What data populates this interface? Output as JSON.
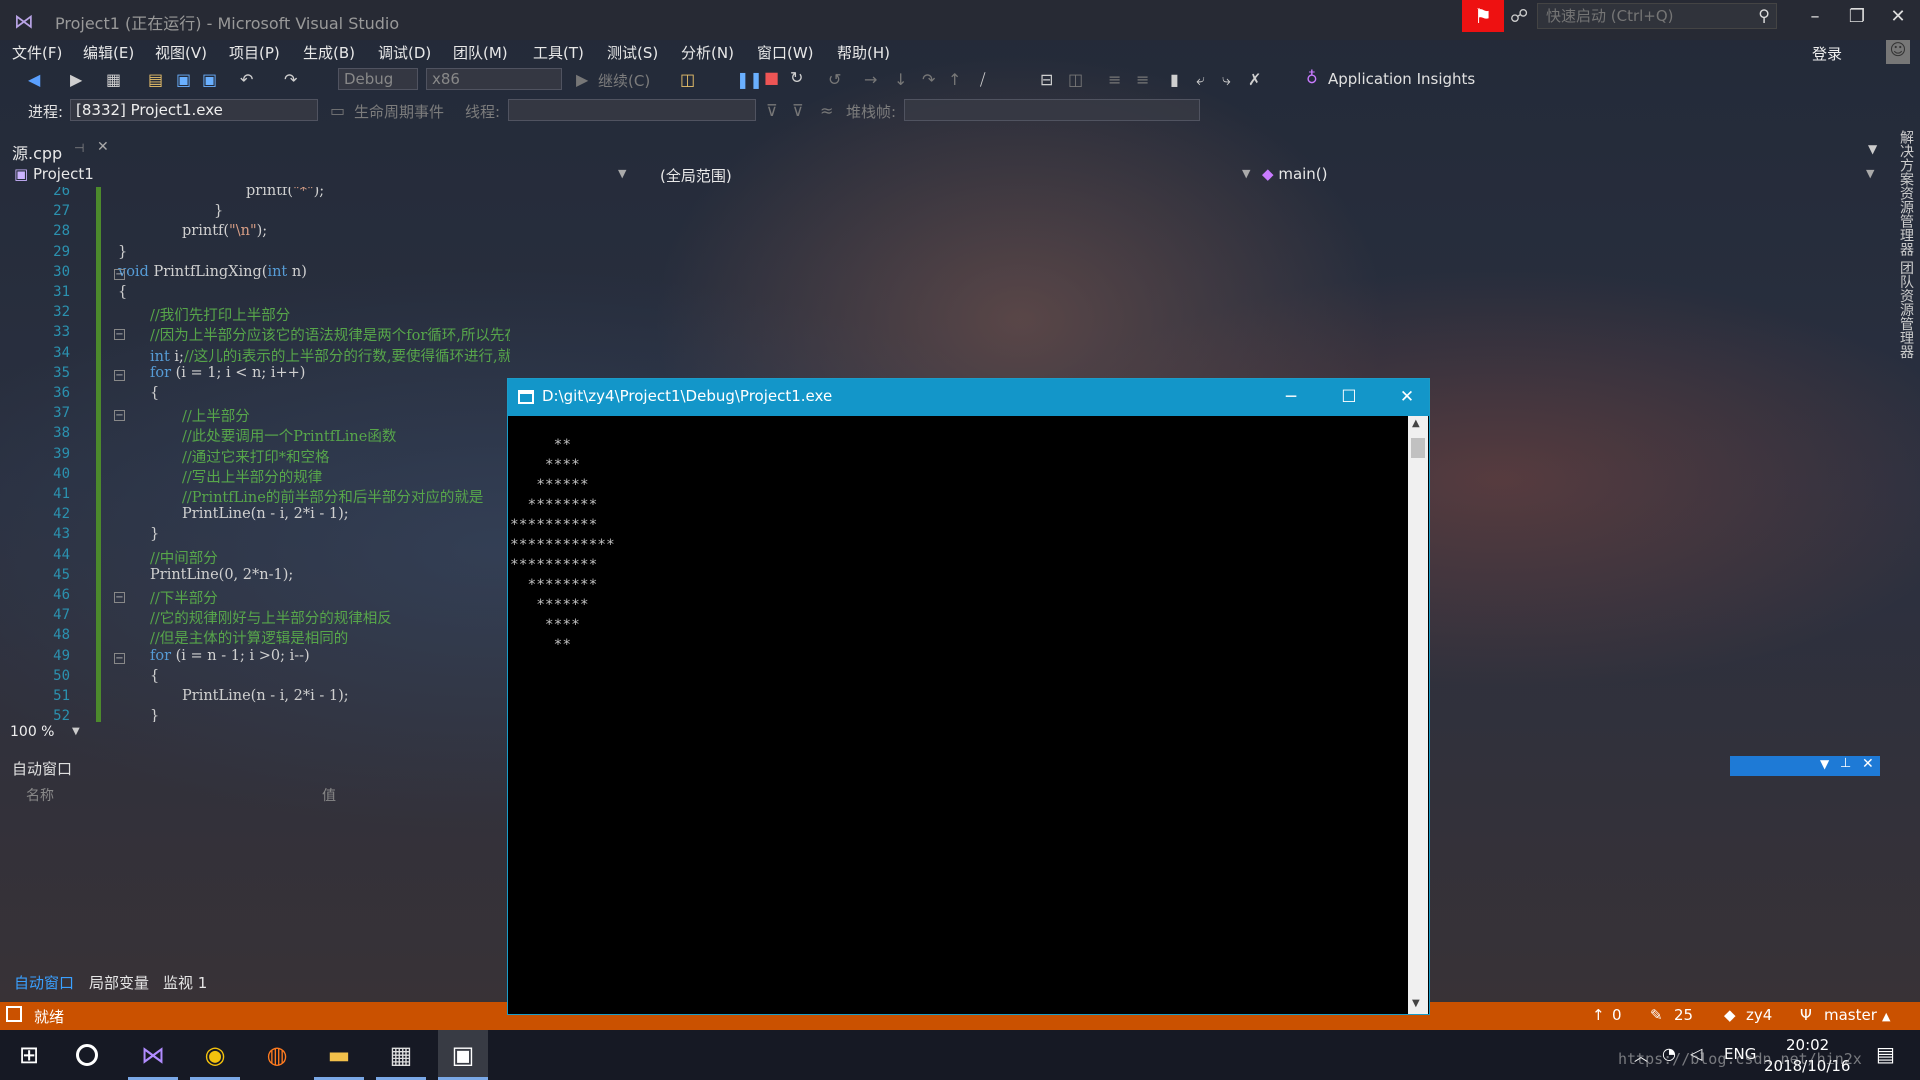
{
  "window": {
    "title": "Project1 (正在运行) - Microsoft Visual Studio",
    "quick_launch_placeholder": "快速启动 (Ctrl+Q)",
    "sign_in": "登录"
  },
  "menu": [
    "文件(F)",
    "编辑(E)",
    "视图(V)",
    "项目(P)",
    "生成(B)",
    "调试(D)",
    "团队(M)",
    "工具(T)",
    "测试(S)",
    "分析(N)",
    "窗口(W)",
    "帮助(H)"
  ],
  "toolbar": {
    "config": "Debug",
    "platform": "x86",
    "continue_label": "继续(C)",
    "app_insights": "Application Insights"
  },
  "debug_location": {
    "process_label": "进程:",
    "process_value": "[8332] Project1.exe",
    "lifecycle_label": "生命周期事件",
    "thread_label": "线程:",
    "stackframe_label": "堆栈帧:"
  },
  "doc_tab": {
    "label": "源.cpp"
  },
  "nav": {
    "project": "Project1",
    "scope": "(全局范围)",
    "member": "main()"
  },
  "editor": {
    "zoom": "100 %",
    "line_numbers": [
      "26",
      "27",
      "28",
      "29",
      "30",
      "31",
      "32",
      "33",
      "34",
      "35",
      "36",
      "37",
      "38",
      "39",
      "40",
      "41",
      "42",
      "43",
      "44",
      "45",
      "46",
      "47",
      "48",
      "49",
      "50",
      "51",
      "52"
    ],
    "lines": [
      "printf(\"*\");",
      "}",
      "printf(\"\\n\");",
      "}",
      "void PrintfLingXing(int n)",
      "{",
      "//我们先打印上半部分",
      "//因为上半部分应该它的语法规律是两个for循环,所以先在这个函数中创建一个for循环",
      "int i;//这儿的i表示的上半部分的行数,要使得循环进行,就必须知道行数与菱形一半部分的关系",
      "for (i = 1; i < n; i++)",
      "{",
      "//上半部分",
      "//此处要调用一个PrintfLine函数",
      "//通过它来打印*和空格",
      "//写出上半部分的规律",
      "//PrintfLine的前半部分和后半部分对应的就是",
      "PrintLine(n - i, 2*i - 1);",
      "}",
      "//中间部分",
      "PrintLine(0, 2*n-1);",
      "//下半部分",
      "//它的规律刚好与上半部分的规律相反",
      "//但是主体的计算逻辑是相同的",
      "for (i = n - 1; i >0; i--)",
      "{",
      "PrintLine(n - i, 2*i - 1);",
      "}"
    ]
  },
  "autos": {
    "title": "自动窗口",
    "col_name": "名称",
    "col_value": "值",
    "tabs": [
      "自动窗口",
      "局部变量",
      "监视 1"
    ]
  },
  "console": {
    "title": "D:\\git\\zy4\\Project1\\Debug\\Project1.exe",
    "output": "     **\n    ****\n   ******\n  ********\n**********\n************\n**********\n  ********\n   ******\n    ****\n     **"
  },
  "right_panel": {
    "vertical_tabs": "解决方案资源管理器  团队资源管理器"
  },
  "status": {
    "ready": "就绪",
    "up_count": "0",
    "pencil_count": "25",
    "repo": "zy4",
    "branch": "master"
  },
  "taskbar": {
    "time": "20:02",
    "date": "2018/10/16",
    "lang": "ENG",
    "watermark": "https://blog.csdn.net/hin2x"
  },
  "colors": {
    "accent": "#ca5100",
    "console_title": "#1396c9",
    "keyword": "#569cd6",
    "comment": "#57a64a"
  }
}
